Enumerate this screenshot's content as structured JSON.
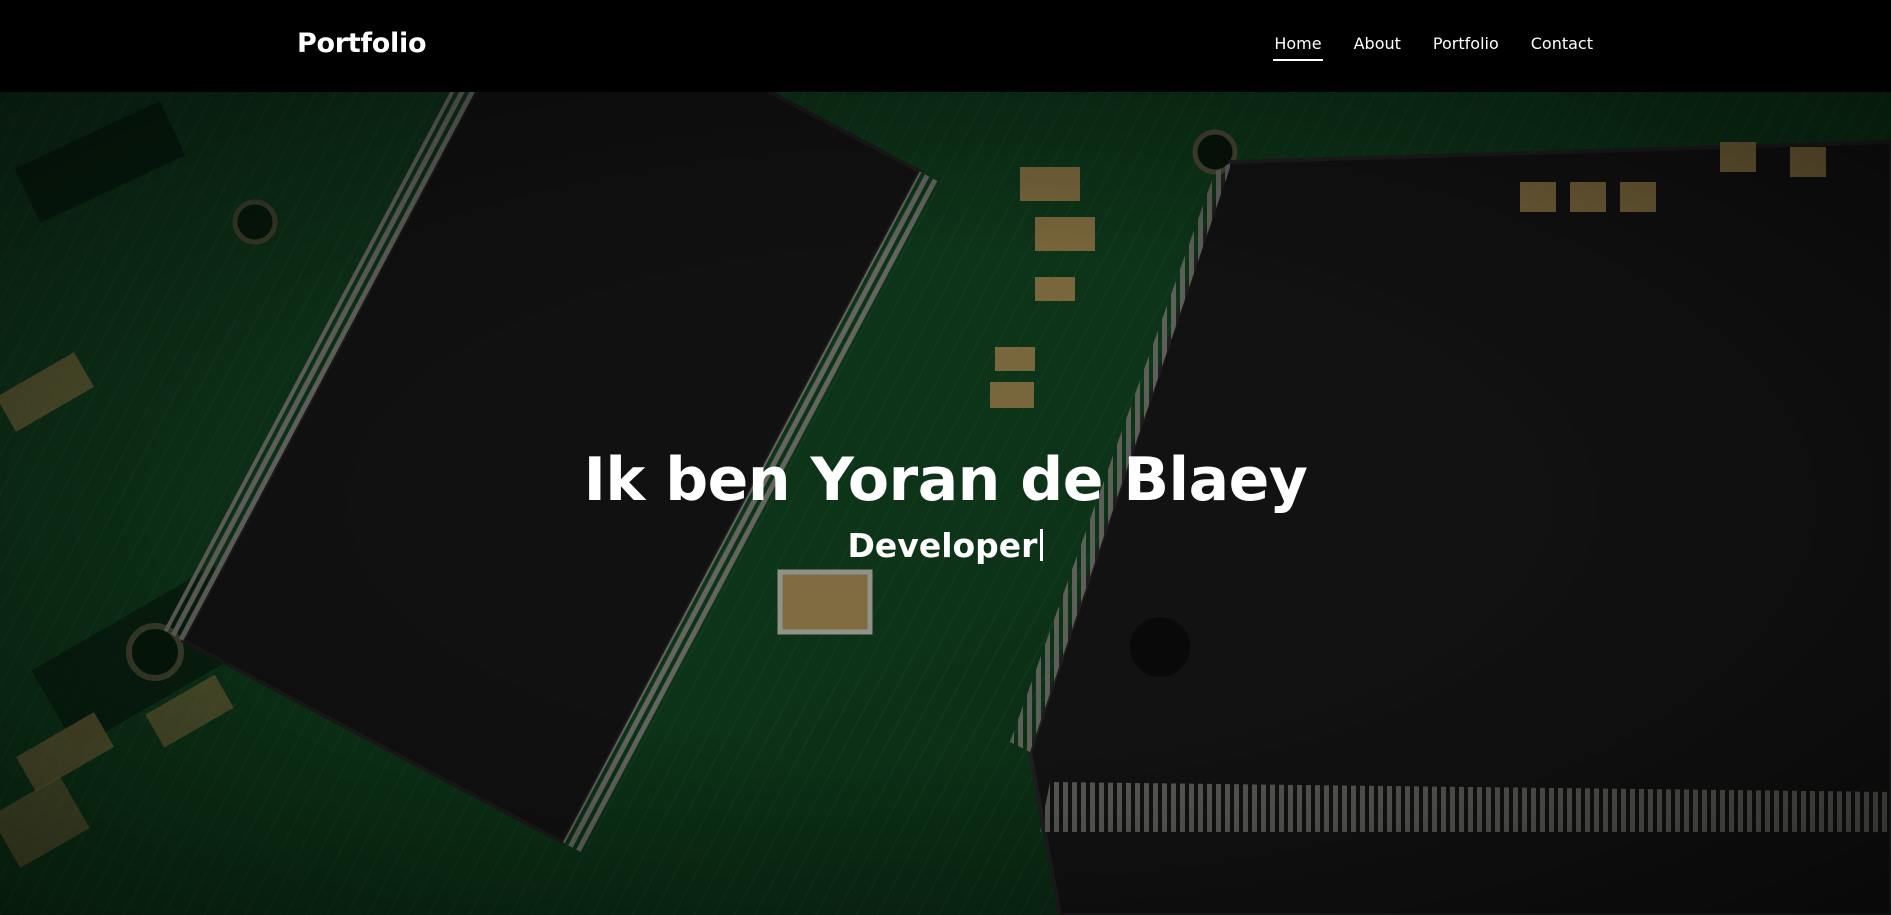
{
  "header": {
    "brand": "Portfolio",
    "nav": [
      {
        "label": "Home",
        "active": true
      },
      {
        "label": "About",
        "active": false
      },
      {
        "label": "Portfolio",
        "active": false
      },
      {
        "label": "Contact",
        "active": false
      }
    ]
  },
  "hero": {
    "title": "Ik ben Yoran de Blaey",
    "subtitle": "Developer"
  },
  "colors": {
    "header_bg": "#000000",
    "text": "#ffffff",
    "pcb_green": "#1c5a2e",
    "chip_dark": "#1a1a1a"
  },
  "icons": {
    "typing_cursor": "text-cursor-icon"
  }
}
